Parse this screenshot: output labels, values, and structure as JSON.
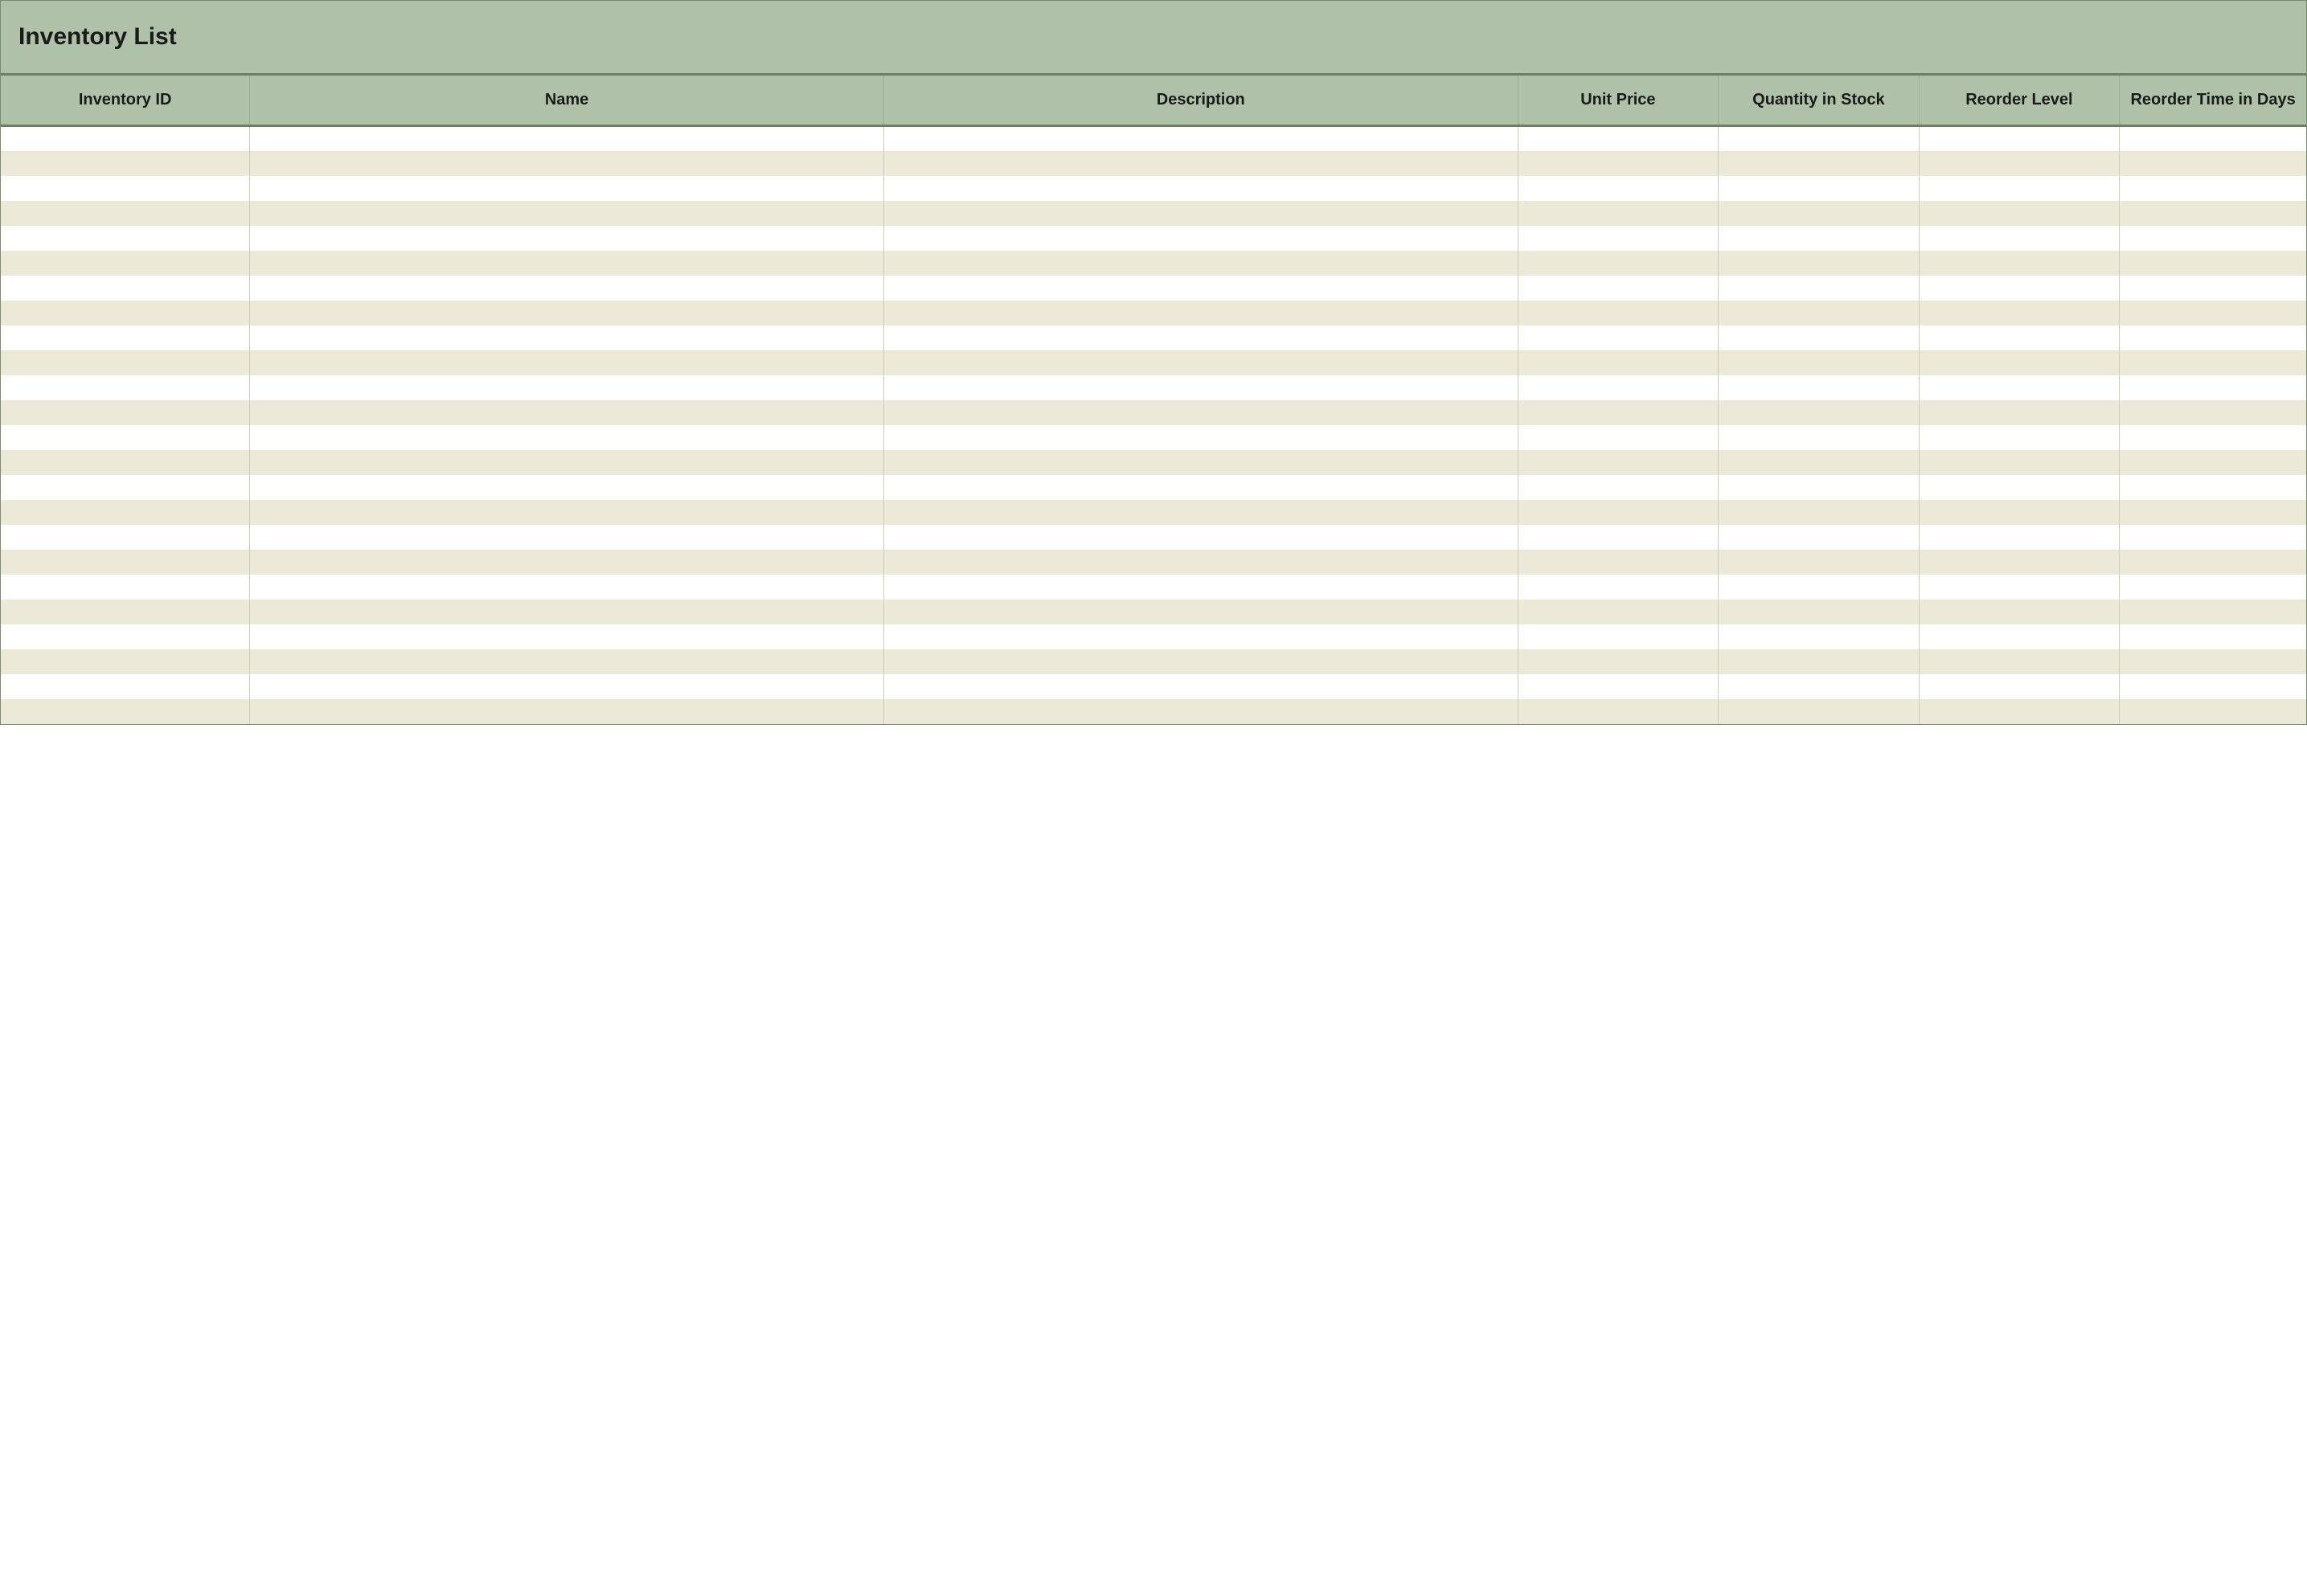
{
  "title": "Inventory List",
  "columns": [
    {
      "key": "inventory_id",
      "label": "Inventory ID"
    },
    {
      "key": "name",
      "label": "Name"
    },
    {
      "key": "description",
      "label": "Description"
    },
    {
      "key": "unit_price",
      "label": "Unit Price"
    },
    {
      "key": "quantity_in_stock",
      "label": "Quantity in Stock"
    },
    {
      "key": "reorder_level",
      "label": "Reorder Level"
    },
    {
      "key": "reorder_time_in_days",
      "label": "Reorder Time in Days"
    }
  ],
  "rows": [
    {
      "inventory_id": "",
      "name": "",
      "description": "",
      "unit_price": "",
      "quantity_in_stock": "",
      "reorder_level": "",
      "reorder_time_in_days": ""
    },
    {
      "inventory_id": "",
      "name": "",
      "description": "",
      "unit_price": "",
      "quantity_in_stock": "",
      "reorder_level": "",
      "reorder_time_in_days": ""
    },
    {
      "inventory_id": "",
      "name": "",
      "description": "",
      "unit_price": "",
      "quantity_in_stock": "",
      "reorder_level": "",
      "reorder_time_in_days": ""
    },
    {
      "inventory_id": "",
      "name": "",
      "description": "",
      "unit_price": "",
      "quantity_in_stock": "",
      "reorder_level": "",
      "reorder_time_in_days": ""
    },
    {
      "inventory_id": "",
      "name": "",
      "description": "",
      "unit_price": "",
      "quantity_in_stock": "",
      "reorder_level": "",
      "reorder_time_in_days": ""
    },
    {
      "inventory_id": "",
      "name": "",
      "description": "",
      "unit_price": "",
      "quantity_in_stock": "",
      "reorder_level": "",
      "reorder_time_in_days": ""
    },
    {
      "inventory_id": "",
      "name": "",
      "description": "",
      "unit_price": "",
      "quantity_in_stock": "",
      "reorder_level": "",
      "reorder_time_in_days": ""
    },
    {
      "inventory_id": "",
      "name": "",
      "description": "",
      "unit_price": "",
      "quantity_in_stock": "",
      "reorder_level": "",
      "reorder_time_in_days": ""
    },
    {
      "inventory_id": "",
      "name": "",
      "description": "",
      "unit_price": "",
      "quantity_in_stock": "",
      "reorder_level": "",
      "reorder_time_in_days": ""
    },
    {
      "inventory_id": "",
      "name": "",
      "description": "",
      "unit_price": "",
      "quantity_in_stock": "",
      "reorder_level": "",
      "reorder_time_in_days": ""
    },
    {
      "inventory_id": "",
      "name": "",
      "description": "",
      "unit_price": "",
      "quantity_in_stock": "",
      "reorder_level": "",
      "reorder_time_in_days": ""
    },
    {
      "inventory_id": "",
      "name": "",
      "description": "",
      "unit_price": "",
      "quantity_in_stock": "",
      "reorder_level": "",
      "reorder_time_in_days": ""
    },
    {
      "inventory_id": "",
      "name": "",
      "description": "",
      "unit_price": "",
      "quantity_in_stock": "",
      "reorder_level": "",
      "reorder_time_in_days": ""
    },
    {
      "inventory_id": "",
      "name": "",
      "description": "",
      "unit_price": "",
      "quantity_in_stock": "",
      "reorder_level": "",
      "reorder_time_in_days": ""
    },
    {
      "inventory_id": "",
      "name": "",
      "description": "",
      "unit_price": "",
      "quantity_in_stock": "",
      "reorder_level": "",
      "reorder_time_in_days": ""
    },
    {
      "inventory_id": "",
      "name": "",
      "description": "",
      "unit_price": "",
      "quantity_in_stock": "",
      "reorder_level": "",
      "reorder_time_in_days": ""
    },
    {
      "inventory_id": "",
      "name": "",
      "description": "",
      "unit_price": "",
      "quantity_in_stock": "",
      "reorder_level": "",
      "reorder_time_in_days": ""
    },
    {
      "inventory_id": "",
      "name": "",
      "description": "",
      "unit_price": "",
      "quantity_in_stock": "",
      "reorder_level": "",
      "reorder_time_in_days": ""
    },
    {
      "inventory_id": "",
      "name": "",
      "description": "",
      "unit_price": "",
      "quantity_in_stock": "",
      "reorder_level": "",
      "reorder_time_in_days": ""
    },
    {
      "inventory_id": "",
      "name": "",
      "description": "",
      "unit_price": "",
      "quantity_in_stock": "",
      "reorder_level": "",
      "reorder_time_in_days": ""
    },
    {
      "inventory_id": "",
      "name": "",
      "description": "",
      "unit_price": "",
      "quantity_in_stock": "",
      "reorder_level": "",
      "reorder_time_in_days": ""
    },
    {
      "inventory_id": "",
      "name": "",
      "description": "",
      "unit_price": "",
      "quantity_in_stock": "",
      "reorder_level": "",
      "reorder_time_in_days": ""
    },
    {
      "inventory_id": "",
      "name": "",
      "description": "",
      "unit_price": "",
      "quantity_in_stock": "",
      "reorder_level": "",
      "reorder_time_in_days": ""
    },
    {
      "inventory_id": "",
      "name": "",
      "description": "",
      "unit_price": "",
      "quantity_in_stock": "",
      "reorder_level": "",
      "reorder_time_in_days": ""
    }
  ]
}
